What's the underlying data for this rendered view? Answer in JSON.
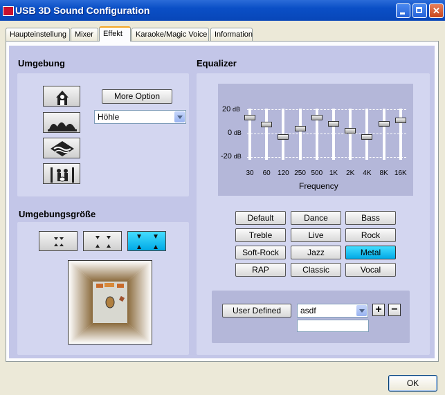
{
  "window": {
    "title": "USB 3D Sound Configuration"
  },
  "tabs": [
    {
      "label": "Haupteinstellung"
    },
    {
      "label": "Mixer"
    },
    {
      "label": "Effekt"
    },
    {
      "label": "Karaoke/Magic Voice"
    },
    {
      "label": "Information"
    }
  ],
  "active_tab": "Effekt",
  "environment": {
    "heading": "Umgebung",
    "more_option": "More Option",
    "selected": "Höhle",
    "icons": [
      "shower-room-icon",
      "opera-house-icon",
      "underwater-icon",
      "concert-icon"
    ]
  },
  "environment_size": {
    "heading": "Umgebungsgröße",
    "sizes": [
      "small-room-icon",
      "medium-room-icon",
      "large-room-icon"
    ],
    "selected_index": 2
  },
  "equalizer": {
    "heading": "Equalizer",
    "db_labels": [
      "20",
      "0",
      "-20"
    ],
    "db_unit": "dB",
    "frequencies": [
      "30",
      "60",
      "120",
      "250",
      "500",
      "1K",
      "2K",
      "4K",
      "8K",
      "16K"
    ],
    "levels": [
      13,
      7,
      -3,
      4,
      13,
      8,
      2,
      -3,
      8,
      11
    ],
    "frequency_label": "Frequency",
    "presets": [
      "Default",
      "Dance",
      "Bass",
      "Treble",
      "Live",
      "Rock",
      "Soft-Rock",
      "Jazz",
      "Metal",
      "RAP",
      "Classic",
      "Vocal"
    ],
    "selected_preset": "Metal",
    "user_defined_label": "User  Defined",
    "user_preset_value": "asdf",
    "user_preset_name": "",
    "add_label": "+",
    "remove_label": "−"
  },
  "footer": {
    "ok_label": "OK"
  },
  "colors": {
    "accent_selected": "#00a9e6",
    "panel_bg": "#c3c6e8",
    "titlebar": "#0a4fc6"
  }
}
